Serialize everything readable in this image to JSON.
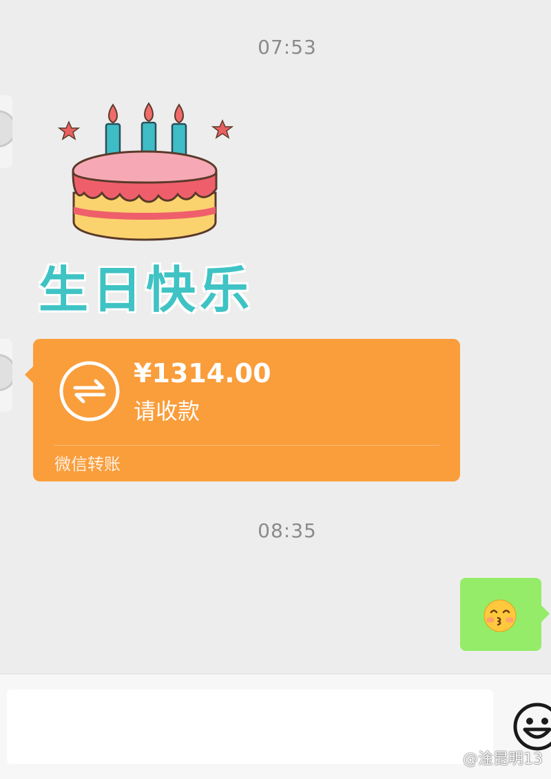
{
  "messages": {
    "time_1": "07:53",
    "sticker_text": "生日快乐",
    "transfer": {
      "amount": "¥1314.00",
      "status": "请收款",
      "footer": "微信转账"
    },
    "time_2": "08:35",
    "reply_emoji": "kissing-face-emoji"
  },
  "input": {
    "placeholder": "",
    "emoji_button_icon": "smiley-icon"
  },
  "watermark": "@淦昆明13",
  "colors": {
    "chat_bg": "#ededed",
    "transfer_orange": "#fa9d3b",
    "my_bubble_green": "#95ec69",
    "sticker_teal": "#3fc3c4"
  }
}
